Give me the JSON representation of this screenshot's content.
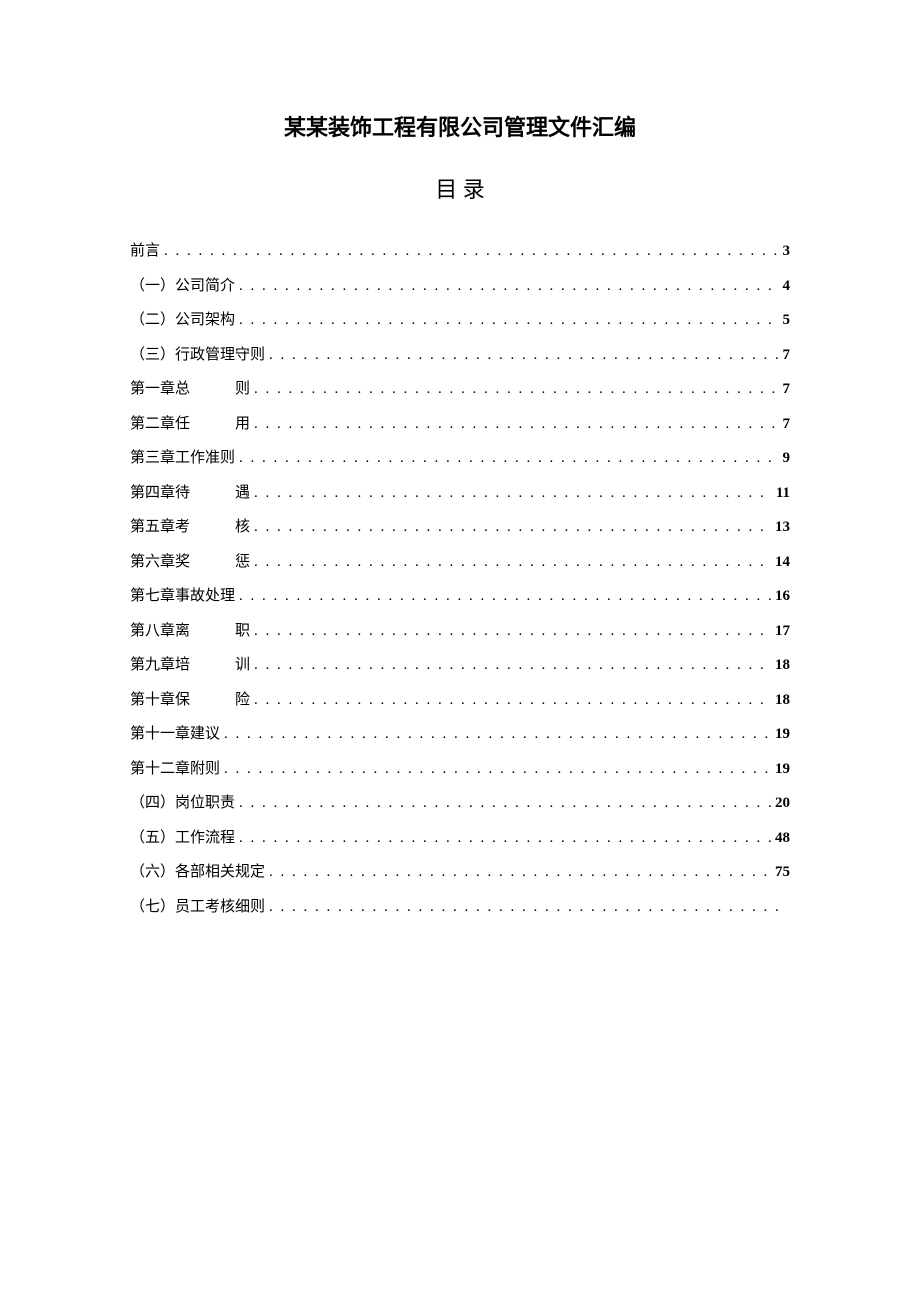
{
  "title": "某某装饰工程有限公司管理文件汇编",
  "tocHeading": "目 录",
  "dots": ". . . . . . . . . . . . . . . . . . . . . . . . . . . . . . . . . . . . . . . . . . . . . . . . . . . . . . . . . . . . . . . . . . . . . . . . . . . . . . . . . . . . . . . . . . . . . . . . . . . . . . . . . . . . . . . . . . . . . . . .",
  "entries": [
    {
      "label": "前言",
      "page": "3",
      "split": false
    },
    {
      "label": "（一）公司简介",
      "page": "4",
      "split": false
    },
    {
      "label": "（二）公司架构",
      "page": "5",
      "split": false
    },
    {
      "label": "（三）行政管理守则",
      "page": "7",
      "split": false
    },
    {
      "left": "第一章总",
      "right": "则",
      "page": "7",
      "split": true
    },
    {
      "left": "第二章任",
      "right": "用",
      "page": "7",
      "split": true
    },
    {
      "label": "第三章工作准则",
      "page": "9",
      "split": false
    },
    {
      "left": "第四章待",
      "right": "遇",
      "page": "11",
      "split": true
    },
    {
      "left": "第五章考",
      "right": "核",
      "page": "13",
      "split": true
    },
    {
      "left": "第六章奖",
      "right": "惩",
      "page": "14",
      "split": true
    },
    {
      "label": "第七章事故处理",
      "page": "16",
      "split": false
    },
    {
      "left": "第八章离",
      "right": "职",
      "page": "17",
      "split": true
    },
    {
      "left": "第九章培",
      "right": "训",
      "page": "18",
      "split": true
    },
    {
      "left": "第十章保",
      "right": "险",
      "page": "18",
      "split": true
    },
    {
      "label": "第十一章建议",
      "page": "19",
      "split": false
    },
    {
      "label": "第十二章附则",
      "page": "19",
      "split": false
    },
    {
      "label": "（四）岗位职责",
      "page": "20",
      "split": false
    },
    {
      "label": "（五）工作流程",
      "page": "48",
      "split": false
    },
    {
      "label": "（六）各部相关规定",
      "page": "75",
      "split": false
    },
    {
      "label": "（七）员工考核细则",
      "page": "",
      "split": false
    }
  ]
}
